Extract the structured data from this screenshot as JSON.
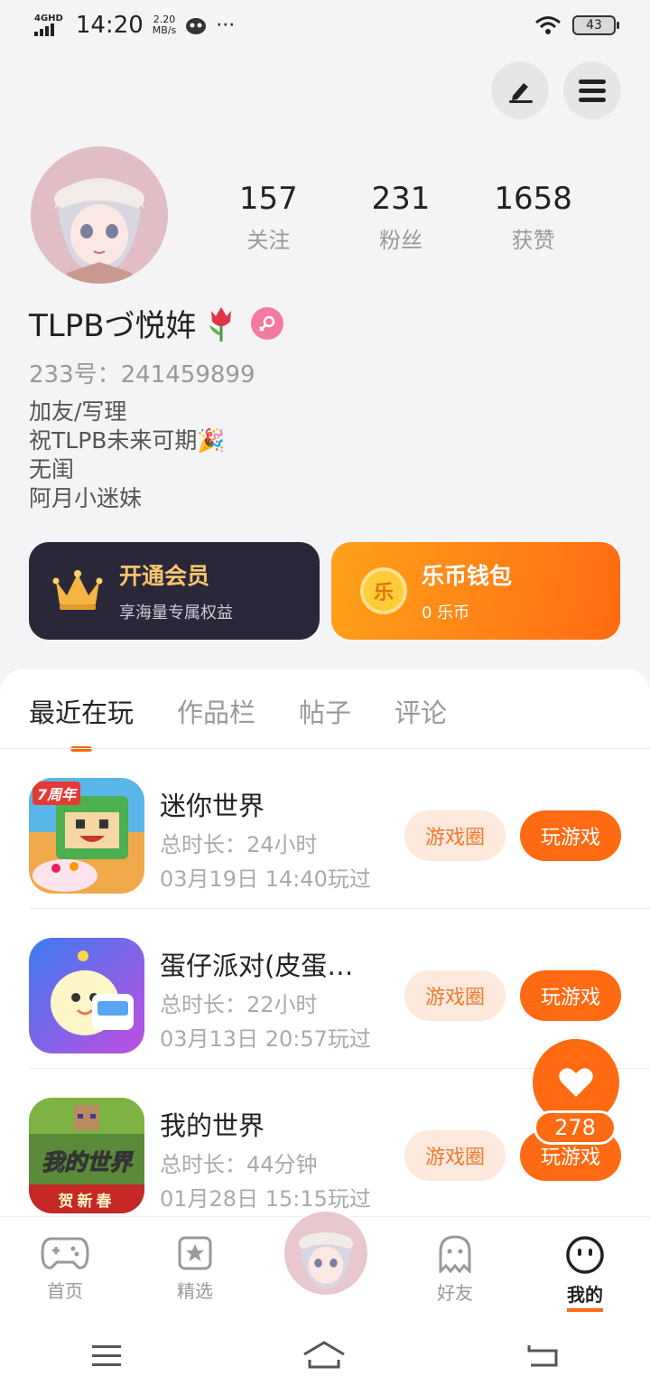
{
  "status_bar": {
    "network": "4GHD",
    "time": "14:20",
    "speed_value": "2.20",
    "speed_unit": "MB/s",
    "more": "···",
    "battery": "43"
  },
  "profile": {
    "stats": [
      {
        "count": "157",
        "label": "关注"
      },
      {
        "count": "231",
        "label": "粉丝"
      },
      {
        "count": "1658",
        "label": "获赞"
      }
    ],
    "username": "TLPBづ悦姩",
    "user_id": "233号：241459899",
    "bio": [
      "加友/写理",
      "祝TLPB未来可期🎉",
      "无闺",
      "阿月小迷妹"
    ]
  },
  "cards": {
    "vip_title": "开通会员",
    "vip_sub": "享海量专属权益",
    "wallet_title": "乐币钱包",
    "wallet_sub": "0 乐币",
    "wallet_coin_char": "乐"
  },
  "tabs": [
    "最近在玩",
    "作品栏",
    "帖子",
    "评论"
  ],
  "games": [
    {
      "name": "迷你世界",
      "duration": "总时长：24小时",
      "last_played": "03月19日 14:40玩过",
      "circle_label": "游戏圈",
      "play_label": "玩游戏",
      "badge": "7周年"
    },
    {
      "name": "蛋仔派对(皮蛋…",
      "duration": "总时长：22小时",
      "last_played": "03月13日 20:57玩过",
      "circle_label": "游戏圈",
      "play_label": "玩游戏"
    },
    {
      "name": "我的世界",
      "duration": "总时长：44分钟",
      "last_played": "01月28日 15:15玩过",
      "circle_label": "游戏圈",
      "play_label": "玩游戏",
      "icon_text": "我的世界",
      "icon_sub": "贺新春"
    }
  ],
  "like_count": "278",
  "bottom_nav": [
    "首页",
    "精选",
    "好友",
    "我的"
  ],
  "colors": {
    "accent": "#ff6a12",
    "vip_bg": "#2a2838",
    "circle_bg": "#fde9dc"
  }
}
